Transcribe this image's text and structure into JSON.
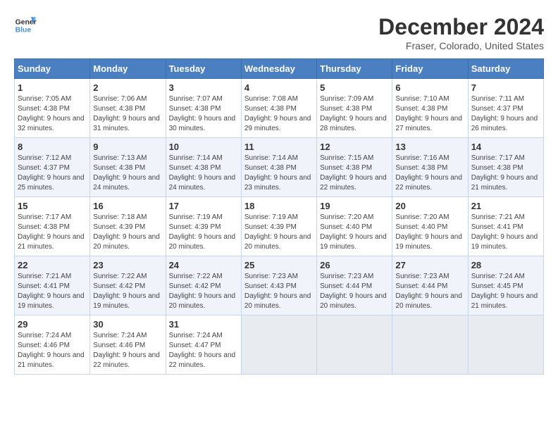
{
  "logo": {
    "line1": "General",
    "line2": "Blue"
  },
  "title": "December 2024",
  "subtitle": "Fraser, Colorado, United States",
  "days_header": [
    "Sunday",
    "Monday",
    "Tuesday",
    "Wednesday",
    "Thursday",
    "Friday",
    "Saturday"
  ],
  "weeks": [
    [
      {
        "day": "1",
        "info": "Sunrise: 7:05 AM\nSunset: 4:38 PM\nDaylight: 9 hours and 32 minutes."
      },
      {
        "day": "2",
        "info": "Sunrise: 7:06 AM\nSunset: 4:38 PM\nDaylight: 9 hours and 31 minutes."
      },
      {
        "day": "3",
        "info": "Sunrise: 7:07 AM\nSunset: 4:38 PM\nDaylight: 9 hours and 30 minutes."
      },
      {
        "day": "4",
        "info": "Sunrise: 7:08 AM\nSunset: 4:38 PM\nDaylight: 9 hours and 29 minutes."
      },
      {
        "day": "5",
        "info": "Sunrise: 7:09 AM\nSunset: 4:38 PM\nDaylight: 9 hours and 28 minutes."
      },
      {
        "day": "6",
        "info": "Sunrise: 7:10 AM\nSunset: 4:38 PM\nDaylight: 9 hours and 27 minutes."
      },
      {
        "day": "7",
        "info": "Sunrise: 7:11 AM\nSunset: 4:37 PM\nDaylight: 9 hours and 26 minutes."
      }
    ],
    [
      {
        "day": "8",
        "info": "Sunrise: 7:12 AM\nSunset: 4:37 PM\nDaylight: 9 hours and 25 minutes."
      },
      {
        "day": "9",
        "info": "Sunrise: 7:13 AM\nSunset: 4:38 PM\nDaylight: 9 hours and 24 minutes."
      },
      {
        "day": "10",
        "info": "Sunrise: 7:14 AM\nSunset: 4:38 PM\nDaylight: 9 hours and 24 minutes."
      },
      {
        "day": "11",
        "info": "Sunrise: 7:14 AM\nSunset: 4:38 PM\nDaylight: 9 hours and 23 minutes."
      },
      {
        "day": "12",
        "info": "Sunrise: 7:15 AM\nSunset: 4:38 PM\nDaylight: 9 hours and 22 minutes."
      },
      {
        "day": "13",
        "info": "Sunrise: 7:16 AM\nSunset: 4:38 PM\nDaylight: 9 hours and 22 minutes."
      },
      {
        "day": "14",
        "info": "Sunrise: 7:17 AM\nSunset: 4:38 PM\nDaylight: 9 hours and 21 minutes."
      }
    ],
    [
      {
        "day": "15",
        "info": "Sunrise: 7:17 AM\nSunset: 4:38 PM\nDaylight: 9 hours and 21 minutes."
      },
      {
        "day": "16",
        "info": "Sunrise: 7:18 AM\nSunset: 4:39 PM\nDaylight: 9 hours and 20 minutes."
      },
      {
        "day": "17",
        "info": "Sunrise: 7:19 AM\nSunset: 4:39 PM\nDaylight: 9 hours and 20 minutes."
      },
      {
        "day": "18",
        "info": "Sunrise: 7:19 AM\nSunset: 4:39 PM\nDaylight: 9 hours and 20 minutes."
      },
      {
        "day": "19",
        "info": "Sunrise: 7:20 AM\nSunset: 4:40 PM\nDaylight: 9 hours and 19 minutes."
      },
      {
        "day": "20",
        "info": "Sunrise: 7:20 AM\nSunset: 4:40 PM\nDaylight: 9 hours and 19 minutes."
      },
      {
        "day": "21",
        "info": "Sunrise: 7:21 AM\nSunset: 4:41 PM\nDaylight: 9 hours and 19 minutes."
      }
    ],
    [
      {
        "day": "22",
        "info": "Sunrise: 7:21 AM\nSunset: 4:41 PM\nDaylight: 9 hours and 19 minutes."
      },
      {
        "day": "23",
        "info": "Sunrise: 7:22 AM\nSunset: 4:42 PM\nDaylight: 9 hours and 19 minutes."
      },
      {
        "day": "24",
        "info": "Sunrise: 7:22 AM\nSunset: 4:42 PM\nDaylight: 9 hours and 20 minutes."
      },
      {
        "day": "25",
        "info": "Sunrise: 7:23 AM\nSunset: 4:43 PM\nDaylight: 9 hours and 20 minutes."
      },
      {
        "day": "26",
        "info": "Sunrise: 7:23 AM\nSunset: 4:44 PM\nDaylight: 9 hours and 20 minutes."
      },
      {
        "day": "27",
        "info": "Sunrise: 7:23 AM\nSunset: 4:44 PM\nDaylight: 9 hours and 20 minutes."
      },
      {
        "day": "28",
        "info": "Sunrise: 7:24 AM\nSunset: 4:45 PM\nDaylight: 9 hours and 21 minutes."
      }
    ],
    [
      {
        "day": "29",
        "info": "Sunrise: 7:24 AM\nSunset: 4:46 PM\nDaylight: 9 hours and 21 minutes."
      },
      {
        "day": "30",
        "info": "Sunrise: 7:24 AM\nSunset: 4:46 PM\nDaylight: 9 hours and 22 minutes."
      },
      {
        "day": "31",
        "info": "Sunrise: 7:24 AM\nSunset: 4:47 PM\nDaylight: 9 hours and 22 minutes."
      },
      null,
      null,
      null,
      null
    ]
  ]
}
